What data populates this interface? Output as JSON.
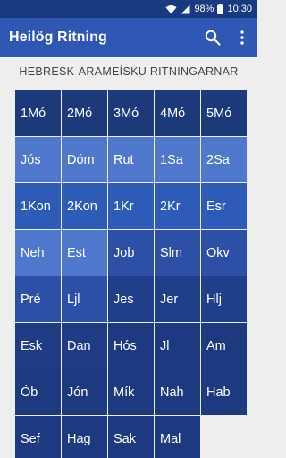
{
  "status_bar": {
    "battery_percent": "98%",
    "time": "10:30",
    "icons": [
      "wifi-icon",
      "signal-icon",
      "battery-icon"
    ]
  },
  "app_bar": {
    "title": "Heilög Ritning",
    "actions": [
      "search-icon",
      "more-vert-icon"
    ]
  },
  "section_title": "HEBRESK-ARAMEÍSKU RITNINGARNAR",
  "books": [
    {
      "label": "1Mó",
      "tone": 1
    },
    {
      "label": "2Mó",
      "tone": 1
    },
    {
      "label": "3Mó",
      "tone": 1
    },
    {
      "label": "4Mó",
      "tone": 1
    },
    {
      "label": "5Mó",
      "tone": 1
    },
    {
      "label": "Jós",
      "tone": 2
    },
    {
      "label": "Dóm",
      "tone": 2
    },
    {
      "label": "Rut",
      "tone": 2
    },
    {
      "label": "1Sa",
      "tone": 2
    },
    {
      "label": "2Sa",
      "tone": 2
    },
    {
      "label": "1Kon",
      "tone": 3
    },
    {
      "label": "2Kon",
      "tone": 3
    },
    {
      "label": "1Kr",
      "tone": 3
    },
    {
      "label": "2Kr",
      "tone": 3
    },
    {
      "label": "Esr",
      "tone": 3
    },
    {
      "label": "Neh",
      "tone": 2
    },
    {
      "label": "Est",
      "tone": 2
    },
    {
      "label": "Job",
      "tone": 4
    },
    {
      "label": "Slm",
      "tone": 4
    },
    {
      "label": "Okv",
      "tone": 4
    },
    {
      "label": "Pré",
      "tone": 4
    },
    {
      "label": "Ljl",
      "tone": 4
    },
    {
      "label": "Jes",
      "tone": 5
    },
    {
      "label": "Jer",
      "tone": 5
    },
    {
      "label": "Hlj",
      "tone": 5
    },
    {
      "label": "Esk",
      "tone": 6
    },
    {
      "label": "Dan",
      "tone": 6
    },
    {
      "label": "Hós",
      "tone": 7
    },
    {
      "label": "Jl",
      "tone": 7
    },
    {
      "label": "Am",
      "tone": 7
    },
    {
      "label": "Ób",
      "tone": 7
    },
    {
      "label": "Jón",
      "tone": 7
    },
    {
      "label": "Mík",
      "tone": 7
    },
    {
      "label": "Nah",
      "tone": 7
    },
    {
      "label": "Hab",
      "tone": 7
    },
    {
      "label": "Sef",
      "tone": 7
    },
    {
      "label": "Hag",
      "tone": 7
    },
    {
      "label": "Sak",
      "tone": 7
    },
    {
      "label": "Mal",
      "tone": 7
    }
  ]
}
